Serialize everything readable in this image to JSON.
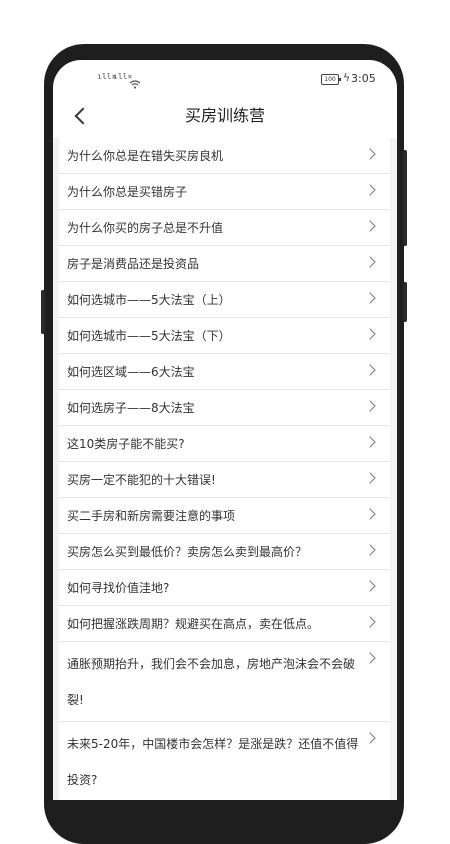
{
  "status_bar": {
    "signal_1": "ıll×",
    "signal_2": "ıll×",
    "wifi": "wifi-icon",
    "battery": "100",
    "time": "3:05"
  },
  "header": {
    "title": "买房训练营"
  },
  "list": {
    "items": [
      {
        "label": "为什么你总是在错失买房良机"
      },
      {
        "label": "为什么你总是买错房子"
      },
      {
        "label": "为什么你买的房子总是不升值"
      },
      {
        "label": "房子是消费品还是投资品"
      },
      {
        "label": "如何选城市——5大法宝（上）"
      },
      {
        "label": "如何选城市——5大法宝（下）"
      },
      {
        "label": "如何选区域——6大法宝"
      },
      {
        "label": "如何选房子——8大法宝"
      },
      {
        "label": "这10类房子能不能买?"
      },
      {
        "label": "买房一定不能犯的十大错误!"
      },
      {
        "label": "买二手房和新房需要注意的事项"
      },
      {
        "label": "买房怎么买到最低价？卖房怎么卖到最高价？"
      },
      {
        "label": "如何寻找价值洼地?"
      },
      {
        "label": "如何把握涨跌周期？规避买在高点，卖在低点。"
      },
      {
        "label": "通胀预期抬升，我们会不会加息，房地产泡沫会不会破裂!"
      },
      {
        "label": "未来5-20年，中国楼市会怎样？是涨是跌？还值不值得投资?"
      }
    ]
  }
}
